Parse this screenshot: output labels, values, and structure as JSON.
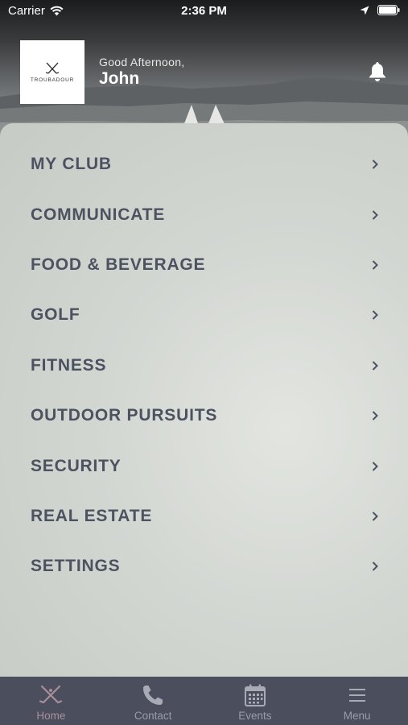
{
  "status_bar": {
    "carrier": "Carrier",
    "time": "2:36 PM"
  },
  "header": {
    "logo_text": "TROUBADOUR",
    "greeting": "Good Afternoon,",
    "user_name": "John"
  },
  "menu": {
    "items": [
      {
        "label": "MY CLUB"
      },
      {
        "label": "COMMUNICATE"
      },
      {
        "label": "FOOD & BEVERAGE"
      },
      {
        "label": "GOLF"
      },
      {
        "label": "FITNESS"
      },
      {
        "label": "OUTDOOR PURSUITS"
      },
      {
        "label": "SECURITY"
      },
      {
        "label": "REAL ESTATE"
      },
      {
        "label": "SETTINGS"
      }
    ]
  },
  "tabbar": {
    "tabs": [
      {
        "label": "Home",
        "icon": "crossed-clubs-icon",
        "active": true
      },
      {
        "label": "Contact",
        "icon": "phone-icon",
        "active": false
      },
      {
        "label": "Events",
        "icon": "calendar-icon",
        "active": false
      },
      {
        "label": "Menu",
        "icon": "hamburger-menu-icon",
        "active": false
      }
    ]
  },
  "colors": {
    "menu_text": "#4c5260",
    "tabbar_bg": "#4b4e5d",
    "tab_active": "#a98e9c",
    "tab_inactive": "#9a9caa"
  }
}
